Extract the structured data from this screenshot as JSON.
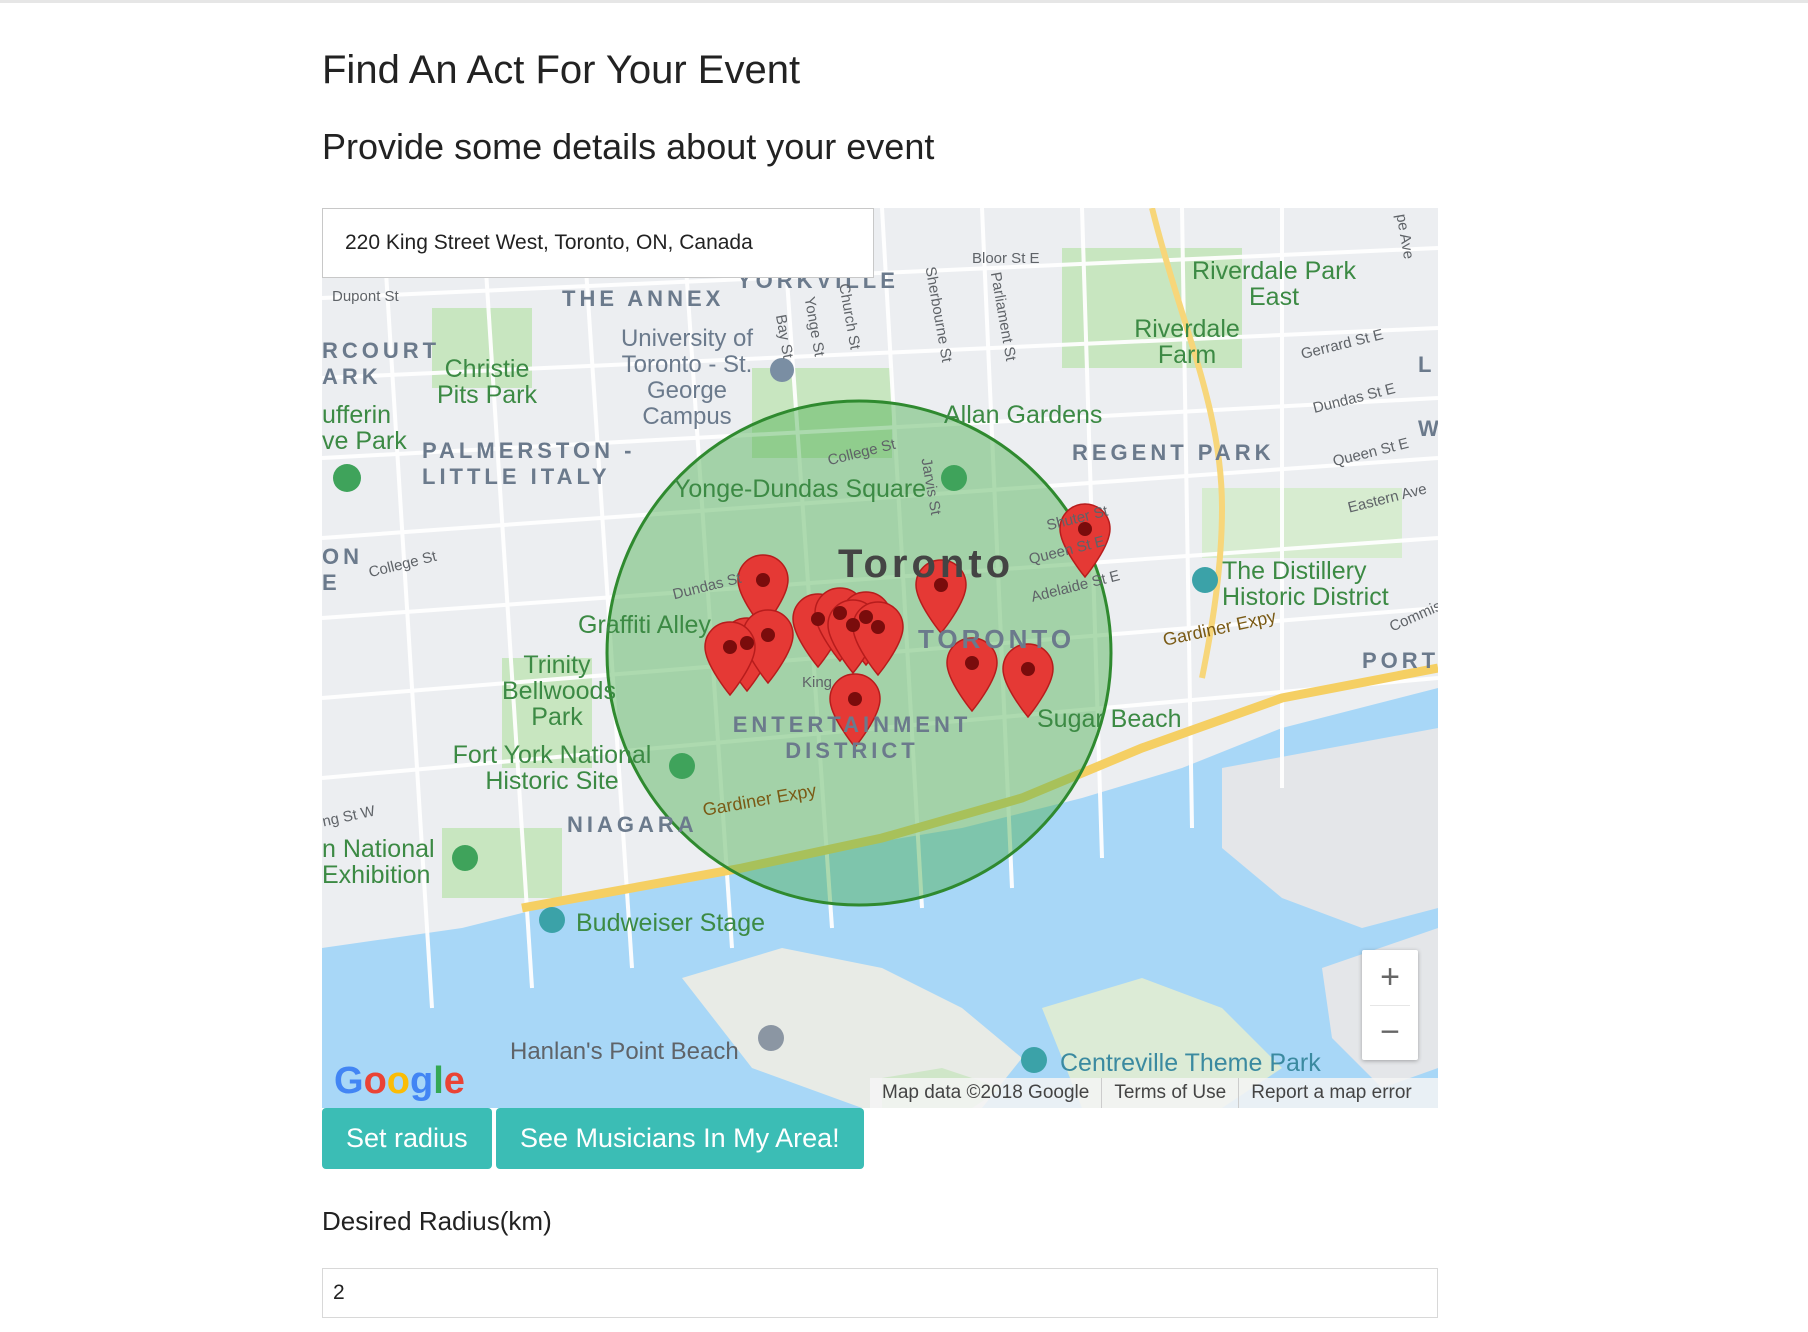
{
  "page": {
    "title": "Find An Act For Your Event",
    "subtitle": "Provide some details about your event"
  },
  "address_input": {
    "value": "220 King Street West, Toronto, ON, Canada"
  },
  "map": {
    "labels": {
      "the_annex": "THE ANNEX",
      "yorkville": "YORKVILLE",
      "dupont": "Dupont St",
      "bloor": "Bloor St E",
      "riverdale_park_east": "Riverdale Park East",
      "riverdale_farm": "Riverdale Farm",
      "rcourt_park": "RCOURT ARK",
      "christie": "Christie Pits Park",
      "uoft": "University of Toronto - St. George Campus",
      "dufferin": "ufferin ve Park",
      "palmerston": "PALMERSTON - LITTLE ITALY",
      "allan_gardens": "Allan Gardens",
      "regent_park": "REGENT PARK",
      "gerrard": "Gerrard St E",
      "dundas_e": "Dundas St E",
      "queen_e": "Queen St E",
      "eastern": "Eastern Ave",
      "college": "College St",
      "college_w": "College St",
      "yonge_dundas": "Yonge-Dundas Square",
      "shuter": "Shuter St",
      "queen_st_e": "Queen St E",
      "adelaide": "Adelaide St E",
      "toronto": "Toronto",
      "old_toronto": "TORONTO",
      "distillery": "The Distillery Historic District",
      "graffiti": "Graffiti Alley",
      "trinity": "Trinity Bellwoods Park",
      "gardiner1": "Gardiner Expy",
      "gardiner2": "Gardiner Expy",
      "port": "PORT",
      "entertainment": "ENTERTAINMENT DISTRICT",
      "sugar_beach": "Sugar Beach",
      "fort_york": "Fort York National Historic Site",
      "niagara": "NIAGARA",
      "cne": "n National Exhibition",
      "budweiser": "Budweiser Stage",
      "hanlans": "Hanlan's Point Beach",
      "centreville": "Centreville Theme Park",
      "ng_st_w": "ng St W",
      "on_e": "ON E",
      "bay": "Bay St",
      "yonge": "Yonge St",
      "church": "Church St",
      "sherbourne": "Sherbourne St",
      "parliament": "Parliament St",
      "jarvis": "Jarvis St",
      "dundas_w": "Dundas St",
      "king": "King",
      "commiss": "Commis",
      "pe_ave": "pe Ave",
      "l_edge": "L",
      "w_edge": "W"
    },
    "google_logo": "Google",
    "attribution": {
      "map_data": "Map data ©2018 Google",
      "terms": "Terms of Use",
      "report": "Report a map error"
    },
    "zoom_in": "+",
    "zoom_out": "−",
    "radius_circle_color": "#4caf50",
    "marker_color": "#e53935"
  },
  "buttons": {
    "set_radius": "Set radius",
    "see_musicians": "See Musicians In My Area!"
  },
  "radius": {
    "label": "Desired Radius(km)",
    "value": "2"
  },
  "colors": {
    "accent": "#3bbdb5",
    "water": "#a8d7f7",
    "park": "#c8e6c0"
  }
}
